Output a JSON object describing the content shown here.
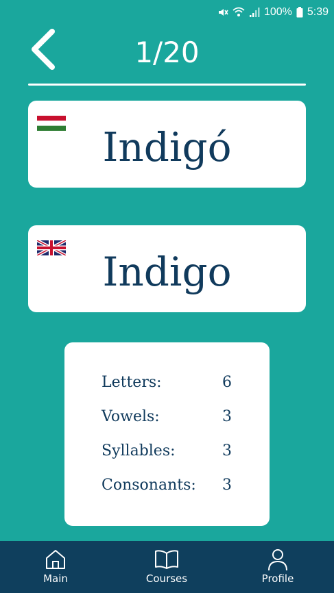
{
  "status_bar": {
    "battery": "100%",
    "time": "5:39",
    "icons": [
      "mute-icon",
      "wifi-icon",
      "signal-icon",
      "battery-icon"
    ]
  },
  "header": {
    "counter": "1/20",
    "back_icon": "chevron-left-icon"
  },
  "cards": {
    "source": {
      "word": "Indigó",
      "flag": "hungary-flag-icon"
    },
    "target": {
      "word": "Indigo",
      "flag": "uk-flag-icon"
    }
  },
  "stats": [
    {
      "label": "Letters:",
      "value": "6"
    },
    {
      "label": "Vowels:",
      "value": "3"
    },
    {
      "label": "Syllables:",
      "value": "3"
    },
    {
      "label": "Consonants:",
      "value": "3"
    }
  ],
  "nav": {
    "items": [
      {
        "label": "Main",
        "icon": "home-icon"
      },
      {
        "label": "Courses",
        "icon": "book-icon"
      },
      {
        "label": "Profile",
        "icon": "user-icon"
      }
    ]
  },
  "colors": {
    "background": "#1aa79d",
    "text_dark": "#103a5c",
    "nav_background": "#0f3f5d",
    "card": "#ffffff"
  }
}
